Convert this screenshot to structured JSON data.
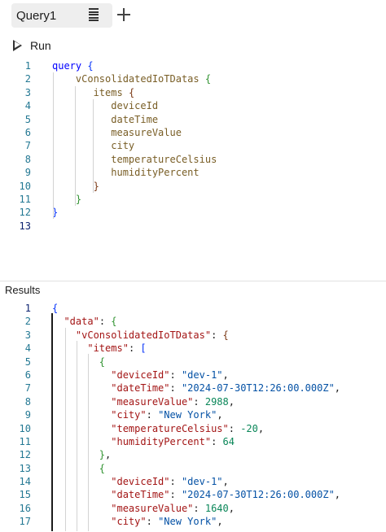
{
  "tab": {
    "label": "Query1"
  },
  "toolbar": {
    "run_label": "Run"
  },
  "editor": {
    "lines": [
      {
        "num": "1",
        "tokens": [
          [
            "query",
            "q-kw"
          ],
          [
            " ",
            ""
          ],
          [
            "{",
            "b1"
          ]
        ]
      },
      {
        "num": "2",
        "tokens": [
          [
            "    ",
            ""
          ],
          [
            "vConsolidatedIoTDatas",
            "q-field"
          ],
          [
            " ",
            ""
          ],
          [
            "{",
            "b2"
          ]
        ]
      },
      {
        "num": "3",
        "tokens": [
          [
            "       ",
            ""
          ],
          [
            "items",
            "q-field"
          ],
          [
            " ",
            ""
          ],
          [
            "{",
            "b3"
          ]
        ]
      },
      {
        "num": "4",
        "tokens": [
          [
            "          ",
            ""
          ],
          [
            "deviceId",
            "q-field"
          ]
        ]
      },
      {
        "num": "5",
        "tokens": [
          [
            "          ",
            ""
          ],
          [
            "dateTime",
            "q-field"
          ]
        ]
      },
      {
        "num": "6",
        "tokens": [
          [
            "          ",
            ""
          ],
          [
            "measureValue",
            "q-field"
          ]
        ]
      },
      {
        "num": "7",
        "tokens": [
          [
            "          ",
            ""
          ],
          [
            "city",
            "q-field"
          ]
        ]
      },
      {
        "num": "8",
        "tokens": [
          [
            "          ",
            ""
          ],
          [
            "temperatureCelsius",
            "q-field"
          ]
        ]
      },
      {
        "num": "9",
        "tokens": [
          [
            "          ",
            ""
          ],
          [
            "humidityPercent",
            "q-field"
          ]
        ]
      },
      {
        "num": "10",
        "tokens": [
          [
            "       ",
            ""
          ],
          [
            "}",
            "b3"
          ]
        ]
      },
      {
        "num": "11",
        "tokens": [
          [
            "    ",
            ""
          ],
          [
            "}",
            "b2"
          ]
        ]
      },
      {
        "num": "12",
        "tokens": [
          [
            "}",
            "b1"
          ]
        ]
      },
      {
        "num": "13",
        "tokens": [],
        "active": true
      }
    ]
  },
  "results": {
    "title": "Results",
    "lines": [
      {
        "num": "1",
        "active": true,
        "tokens": [
          [
            "{",
            "b1"
          ]
        ]
      },
      {
        "num": "2",
        "tokens": [
          [
            "  ",
            ""
          ],
          [
            "\"data\"",
            "j-key"
          ],
          [
            ": ",
            "j-punct"
          ],
          [
            "{",
            "b2"
          ]
        ]
      },
      {
        "num": "3",
        "tokens": [
          [
            "    ",
            ""
          ],
          [
            "\"vConsolidatedIoTDatas\"",
            "j-key"
          ],
          [
            ": ",
            "j-punct"
          ],
          [
            "{",
            "b3"
          ]
        ]
      },
      {
        "num": "4",
        "tokens": [
          [
            "      ",
            ""
          ],
          [
            "\"items\"",
            "j-key"
          ],
          [
            ": ",
            "j-punct"
          ],
          [
            "[",
            "b1"
          ]
        ]
      },
      {
        "num": "5",
        "tokens": [
          [
            "        ",
            ""
          ],
          [
            "{",
            "b2"
          ]
        ]
      },
      {
        "num": "6",
        "tokens": [
          [
            "          ",
            ""
          ],
          [
            "\"deviceId\"",
            "j-key"
          ],
          [
            ": ",
            "j-punct"
          ],
          [
            "\"dev-1\"",
            "j-str"
          ],
          [
            ",",
            "j-punct"
          ]
        ]
      },
      {
        "num": "7",
        "tokens": [
          [
            "          ",
            ""
          ],
          [
            "\"dateTime\"",
            "j-key"
          ],
          [
            ": ",
            "j-punct"
          ],
          [
            "\"2024-07-30T12:26:00.000Z\"",
            "j-str"
          ],
          [
            ",",
            "j-punct"
          ]
        ]
      },
      {
        "num": "8",
        "tokens": [
          [
            "          ",
            ""
          ],
          [
            "\"measureValue\"",
            "j-key"
          ],
          [
            ": ",
            "j-punct"
          ],
          [
            "2988",
            "j-num"
          ],
          [
            ",",
            "j-punct"
          ]
        ]
      },
      {
        "num": "9",
        "tokens": [
          [
            "          ",
            ""
          ],
          [
            "\"city\"",
            "j-key"
          ],
          [
            ": ",
            "j-punct"
          ],
          [
            "\"New York\"",
            "j-str"
          ],
          [
            ",",
            "j-punct"
          ]
        ]
      },
      {
        "num": "10",
        "tokens": [
          [
            "          ",
            ""
          ],
          [
            "\"temperatureCelsius\"",
            "j-key"
          ],
          [
            ": ",
            "j-punct"
          ],
          [
            "-20",
            "j-num"
          ],
          [
            ",",
            "j-punct"
          ]
        ]
      },
      {
        "num": "11",
        "tokens": [
          [
            "          ",
            ""
          ],
          [
            "\"humidityPercent\"",
            "j-key"
          ],
          [
            ": ",
            "j-punct"
          ],
          [
            "64",
            "j-num"
          ]
        ]
      },
      {
        "num": "12",
        "tokens": [
          [
            "        ",
            ""
          ],
          [
            "}",
            "b2"
          ],
          [
            ",",
            "j-punct"
          ]
        ]
      },
      {
        "num": "13",
        "tokens": [
          [
            "        ",
            ""
          ],
          [
            "{",
            "b2"
          ]
        ]
      },
      {
        "num": "14",
        "tokens": [
          [
            "          ",
            ""
          ],
          [
            "\"deviceId\"",
            "j-key"
          ],
          [
            ": ",
            "j-punct"
          ],
          [
            "\"dev-1\"",
            "j-str"
          ],
          [
            ",",
            "j-punct"
          ]
        ]
      },
      {
        "num": "15",
        "tokens": [
          [
            "          ",
            ""
          ],
          [
            "\"dateTime\"",
            "j-key"
          ],
          [
            ": ",
            "j-punct"
          ],
          [
            "\"2024-07-30T12:26:00.000Z\"",
            "j-str"
          ],
          [
            ",",
            "j-punct"
          ]
        ]
      },
      {
        "num": "16",
        "tokens": [
          [
            "          ",
            ""
          ],
          [
            "\"measureValue\"",
            "j-key"
          ],
          [
            ": ",
            "j-punct"
          ],
          [
            "1640",
            "j-num"
          ],
          [
            ",",
            "j-punct"
          ]
        ]
      },
      {
        "num": "17",
        "tokens": [
          [
            "          ",
            ""
          ],
          [
            "\"city\"",
            "j-key"
          ],
          [
            ": ",
            "j-punct"
          ],
          [
            "\"New York\"",
            "j-str"
          ],
          [
            ",",
            "j-punct"
          ]
        ]
      }
    ]
  }
}
